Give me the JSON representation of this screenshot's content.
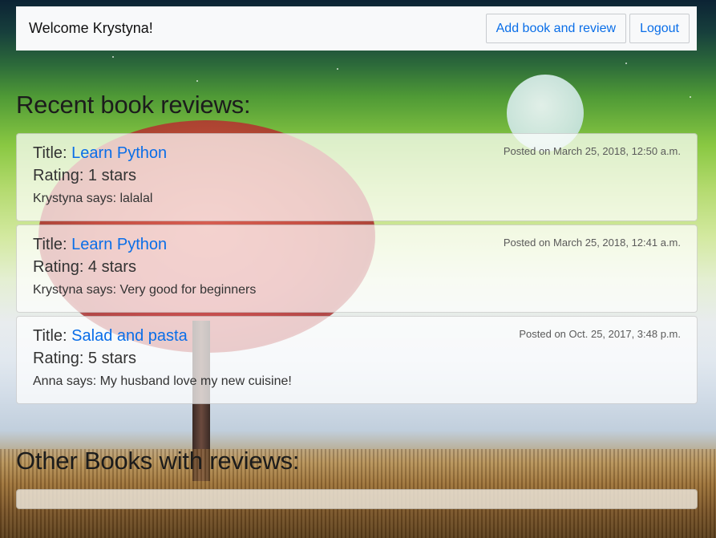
{
  "navbar": {
    "welcome": "Welcome Krystyna!",
    "add_button": "Add book and review",
    "logout_button": "Logout"
  },
  "recent": {
    "heading": "Recent book reviews:",
    "reviews": [
      {
        "title_label": "Title:",
        "book": "Learn Python",
        "posted": "Posted on March 25, 2018, 12:50 a.m.",
        "rating": "Rating: 1 stars",
        "text": "Krystyna says: lalalal"
      },
      {
        "title_label": "Title:",
        "book": "Learn Python",
        "posted": "Posted on March 25, 2018, 12:41 a.m.",
        "rating": "Rating: 4 stars",
        "text": "Krystyna says: Very good for beginners"
      },
      {
        "title_label": "Title:",
        "book": "Salad and pasta",
        "posted": "Posted on Oct. 25, 2017, 3:48 p.m.",
        "rating": "Rating: 5 stars",
        "text": "Anna says: My husband love my new cuisine!"
      }
    ]
  },
  "other": {
    "heading": "Other Books with reviews:"
  },
  "colors": {
    "link": "#0a6ee8",
    "navbar_bg": "#f8f9fa"
  }
}
